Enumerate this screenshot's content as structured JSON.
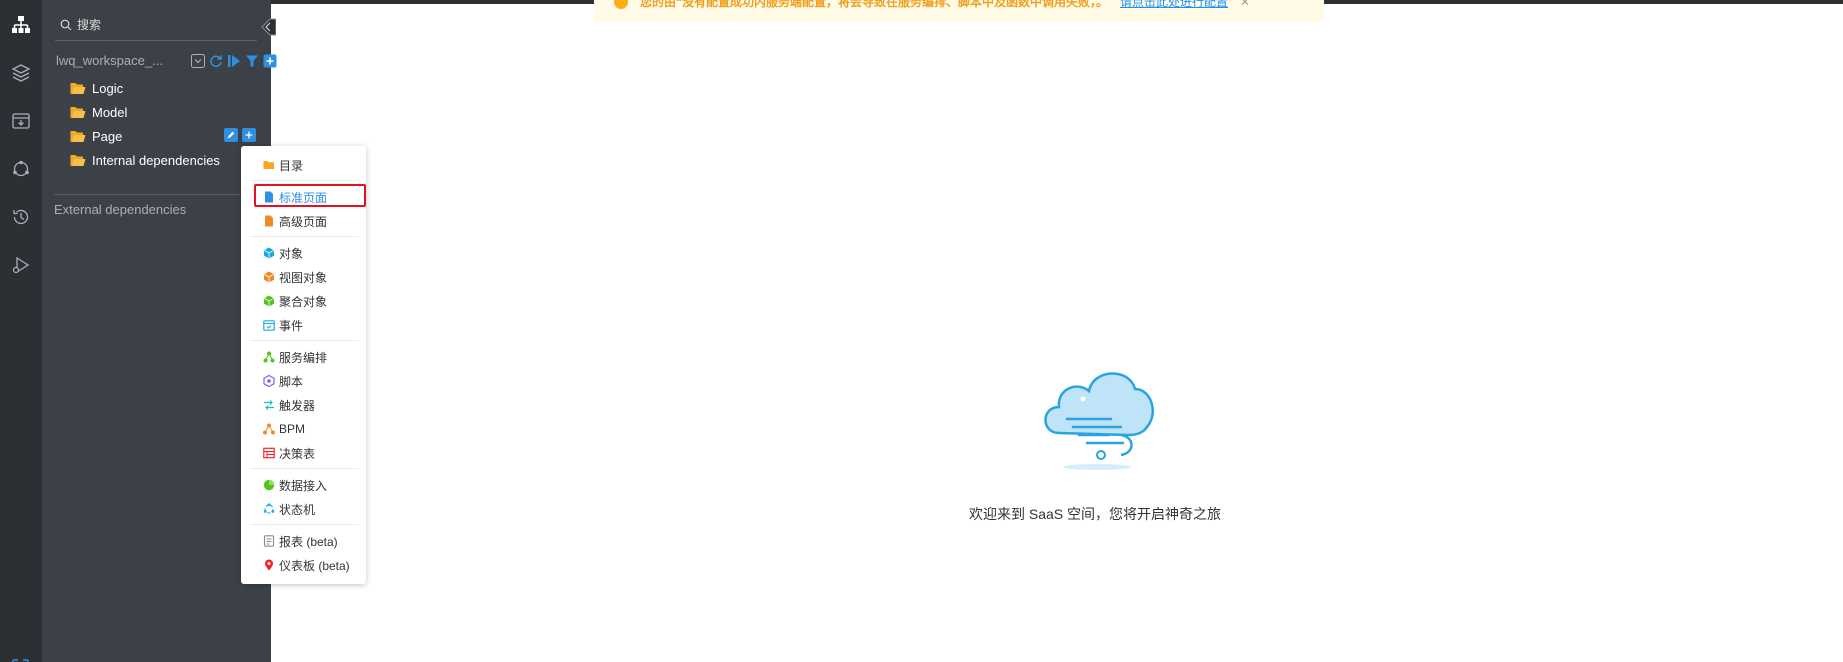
{
  "search": {
    "placeholder": "搜索"
  },
  "workspace": {
    "name": "lwq_workspace_..."
  },
  "tree": [
    {
      "label": "Logic"
    },
    {
      "label": "Model"
    },
    {
      "label": "Page"
    },
    {
      "label": "Internal dependencies"
    }
  ],
  "external_dependencies": "External dependencies",
  "context_menu": {
    "groups": [
      [
        {
          "label": "目录",
          "icon": "folder-icon",
          "color": "#f5a623"
        }
      ],
      [
        {
          "label": "标准页面",
          "icon": "document-icon",
          "color": "#2f8fe0"
        },
        {
          "label": "高级页面",
          "icon": "document-icon",
          "color": "#f08a24"
        }
      ],
      [
        {
          "label": "对象",
          "icon": "cube-icon",
          "color": "#1ea7e8"
        },
        {
          "label": "视图对象",
          "icon": "cube-icon",
          "color": "#f08a24"
        },
        {
          "label": "聚合对象",
          "icon": "cube-icon",
          "color": "#52c41a"
        },
        {
          "label": "事件",
          "icon": "calendar-icon",
          "color": "#1ea7e8"
        }
      ],
      [
        {
          "label": "服务编排",
          "icon": "orchestration-icon",
          "color": "#52c41a"
        },
        {
          "label": "脚本",
          "icon": "script-icon",
          "color": "#7b61ff"
        },
        {
          "label": "触发器",
          "icon": "trigger-icon",
          "color": "#13c2c2"
        },
        {
          "label": "BPM",
          "icon": "bpm-icon",
          "color": "#f08a24"
        },
        {
          "label": "决策表",
          "icon": "table-icon",
          "color": "#f5222d"
        }
      ],
      [
        {
          "label": "数据接入",
          "icon": "pie-icon",
          "color": "#52c41a"
        },
        {
          "label": "状态机",
          "icon": "state-machine-icon",
          "color": "#1ea7e8"
        }
      ],
      [
        {
          "label": "报表 (beta)",
          "icon": "report-icon",
          "color": "#8c8c8c"
        },
        {
          "label": "仪表板 (beta)",
          "icon": "pin-icon",
          "color": "#f5222d"
        }
      ]
    ],
    "active_label": "标准页面"
  },
  "banner": {
    "text": "您的由“没有配置成功内服务端配置，将会导致在服务编排、脚本中及函数中调用失败，。",
    "link": "请点击此处进行配置"
  },
  "empty_state": {
    "message": "欢迎来到 SaaS 空间，您将开启神奇之旅"
  },
  "colors": {
    "rail": "#2b3035",
    "panel": "#3c4148",
    "accent": "#2f8fe0",
    "highlight": "#e6111e"
  }
}
